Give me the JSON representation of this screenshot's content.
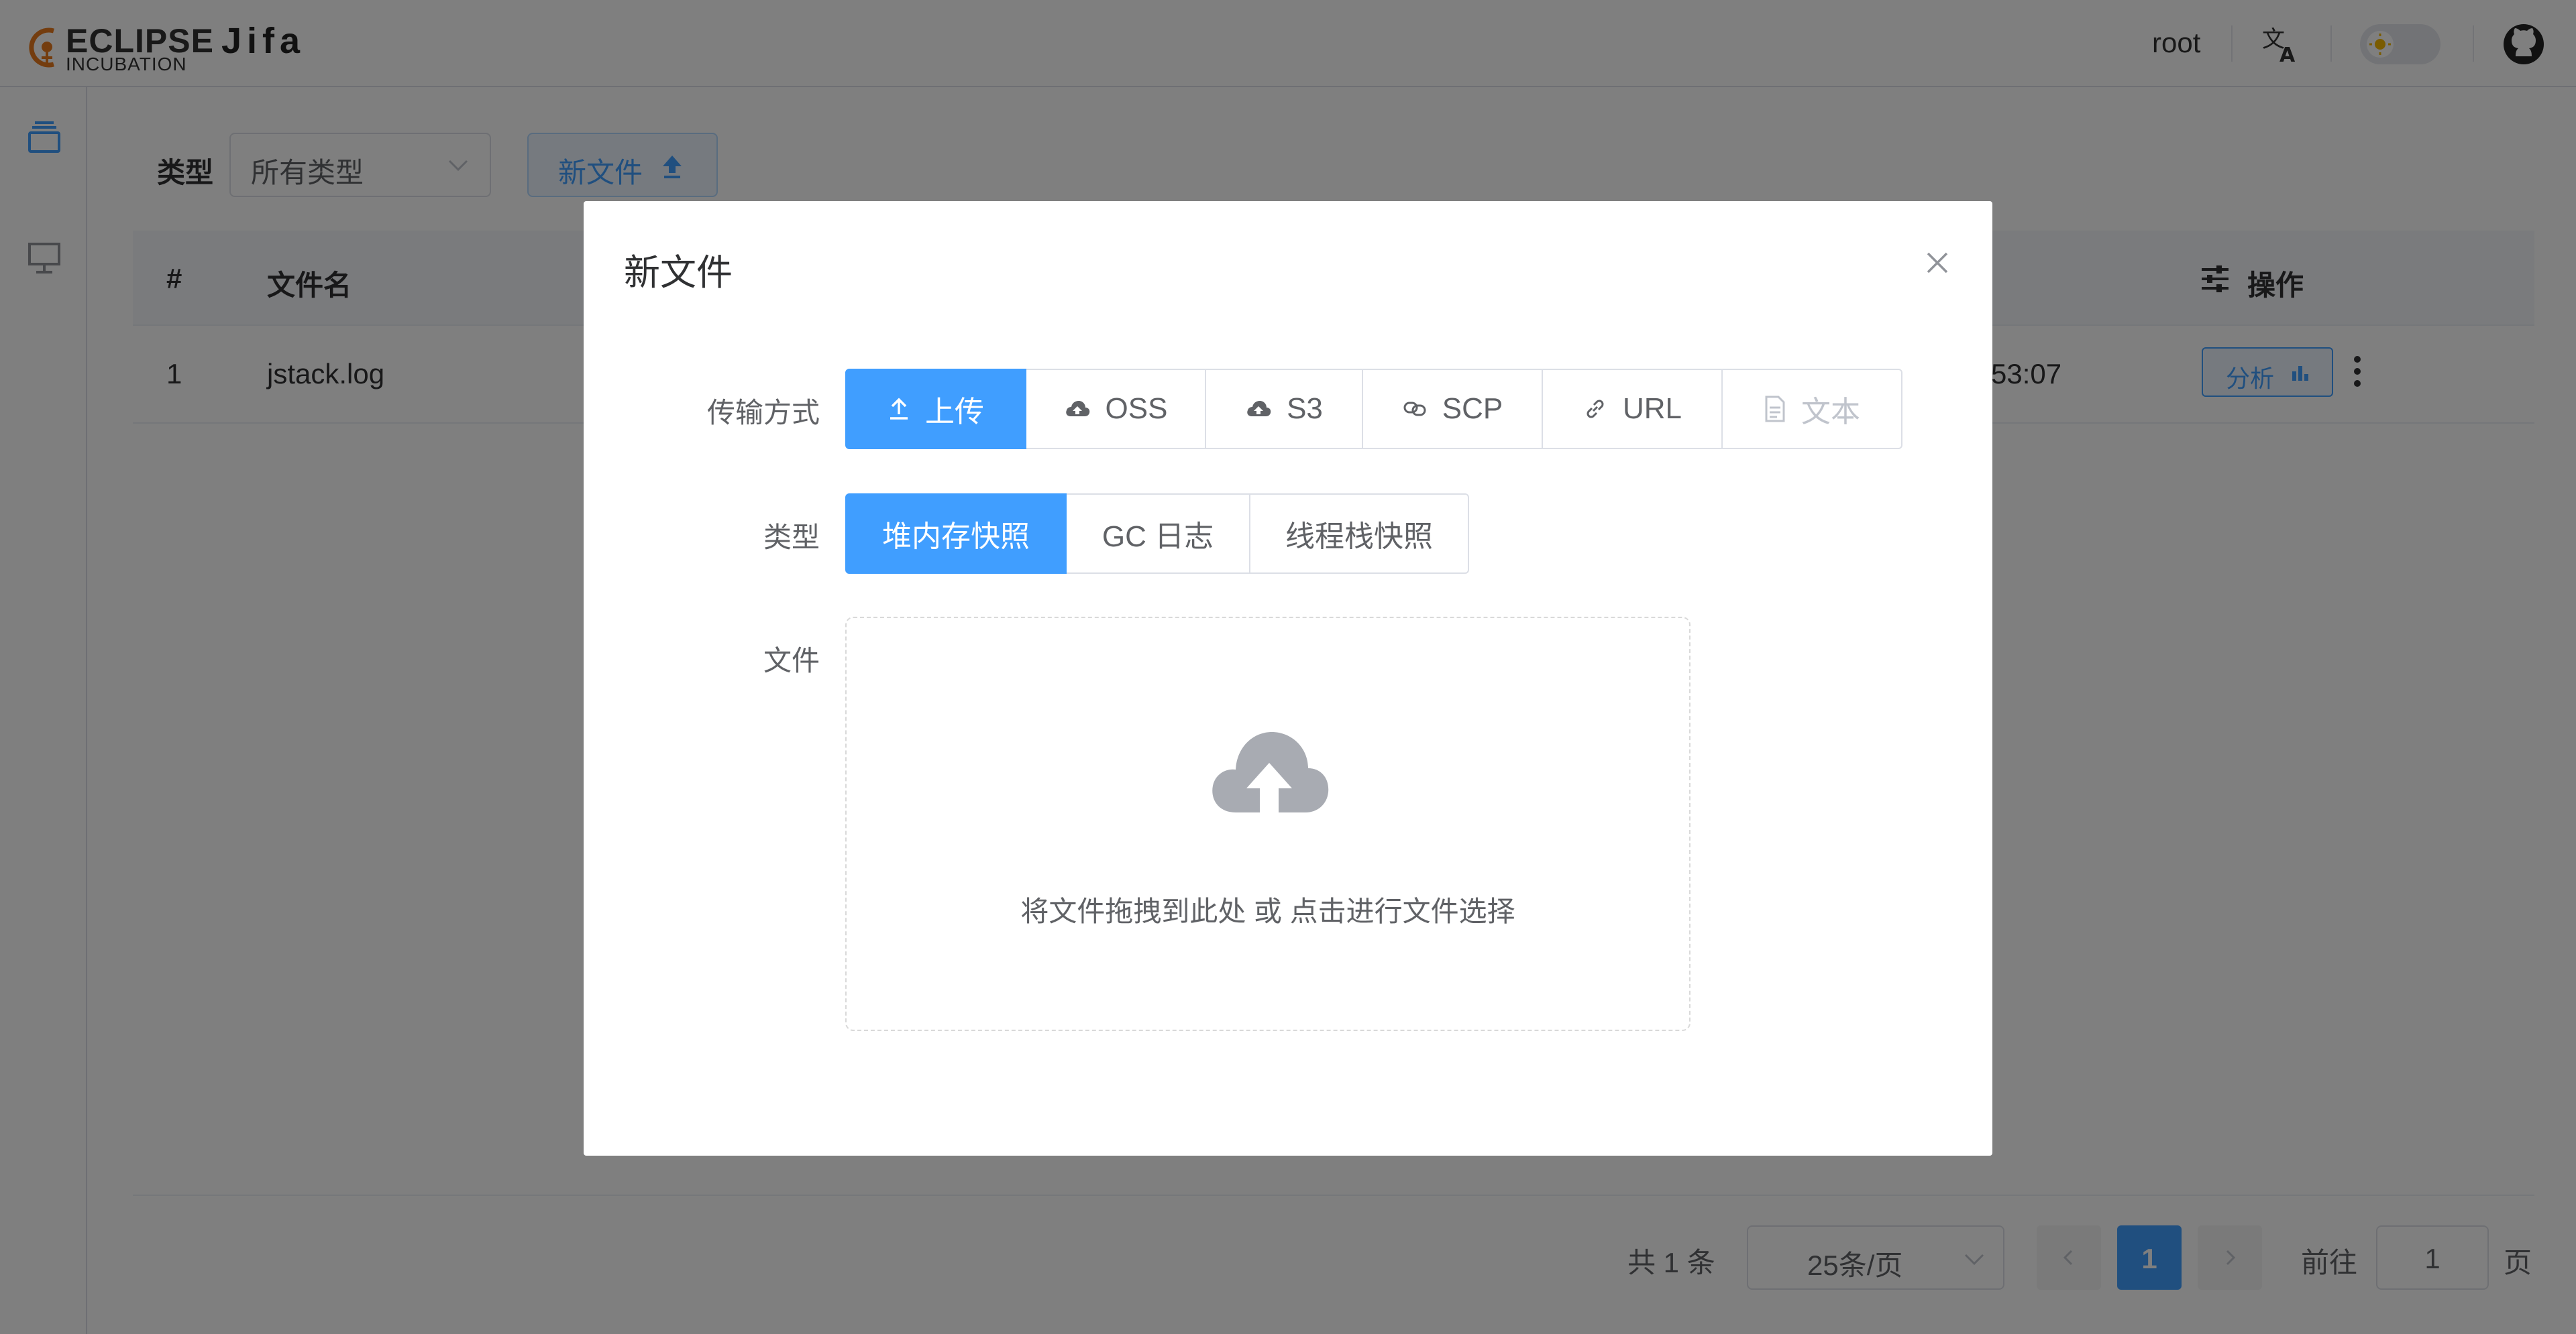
{
  "header": {
    "logo_line1": "ECLIPSE",
    "logo_line2": "INCUBATION",
    "app_name": "Jifa",
    "user": "root"
  },
  "toolbar": {
    "type_label": "类型",
    "type_select_value": "所有类型",
    "new_file_label": "新文件"
  },
  "table": {
    "columns": [
      "#",
      "文件名",
      "操作"
    ],
    "rows": [
      {
        "index": "1",
        "filename": "jstack.log",
        "time_partial": "53:07",
        "analyze_label": "分析"
      }
    ]
  },
  "pagination": {
    "total": "共 1 条",
    "page_size": "25条/页",
    "current_page": "1",
    "goto_label": "前往",
    "goto_value": "1",
    "page_suffix": "页"
  },
  "dialog": {
    "title": "新文件",
    "transfer_label": "传输方式",
    "transfer_options": [
      "上传",
      "OSS",
      "S3",
      "SCP",
      "URL",
      "文本"
    ],
    "transfer_selected": "上传",
    "type_label": "类型",
    "type_options": [
      "堆内存快照",
      "GC 日志",
      "线程栈快照"
    ],
    "type_selected": "堆内存快照",
    "file_label": "文件",
    "upload_hint": "将文件拖拽到此处 或 点击进行文件选择"
  },
  "colors": {
    "primary": "#409eff",
    "overlay": "rgba(0,0,0,0.5)",
    "pager_active": "#409eff"
  },
  "icons": [
    "eclipse-logo-icon",
    "translate-icon",
    "theme-toggle-icon",
    "github-icon",
    "sidebar-files-icon",
    "sidebar-presentation-icon",
    "select-chevron-icon",
    "upload-arrow-icon",
    "settings-sliders-icon",
    "bar-chart-icon",
    "more-vertical-icon",
    "close-icon",
    "cloud-icon",
    "link-icon",
    "document-icon",
    "cloud-upload-icon",
    "chevron-left-icon",
    "chevron-right-icon"
  ]
}
